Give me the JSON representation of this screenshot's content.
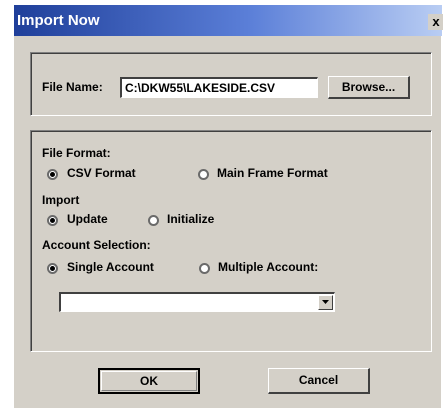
{
  "window": {
    "title": "Import Now",
    "close_label": "x"
  },
  "file": {
    "label": "File Name:",
    "value": "C:\\DKW55\\LAKESIDE.CSV",
    "browse_label": "Browse..."
  },
  "file_format": {
    "label": "File Format:",
    "options": [
      {
        "label": "CSV Format",
        "selected": true
      },
      {
        "label": "Main Frame Format",
        "selected": false
      }
    ]
  },
  "import": {
    "label": "Import",
    "options": [
      {
        "label": "Update",
        "selected": true
      },
      {
        "label": "Initialize",
        "selected": false
      }
    ]
  },
  "account_selection": {
    "label": "Account Selection:",
    "options": [
      {
        "label": "Single Account",
        "selected": true
      },
      {
        "label": "Multiple Account:",
        "selected": false
      }
    ],
    "account_value": ""
  },
  "buttons": {
    "ok_label": "OK",
    "cancel_label": "Cancel"
  }
}
